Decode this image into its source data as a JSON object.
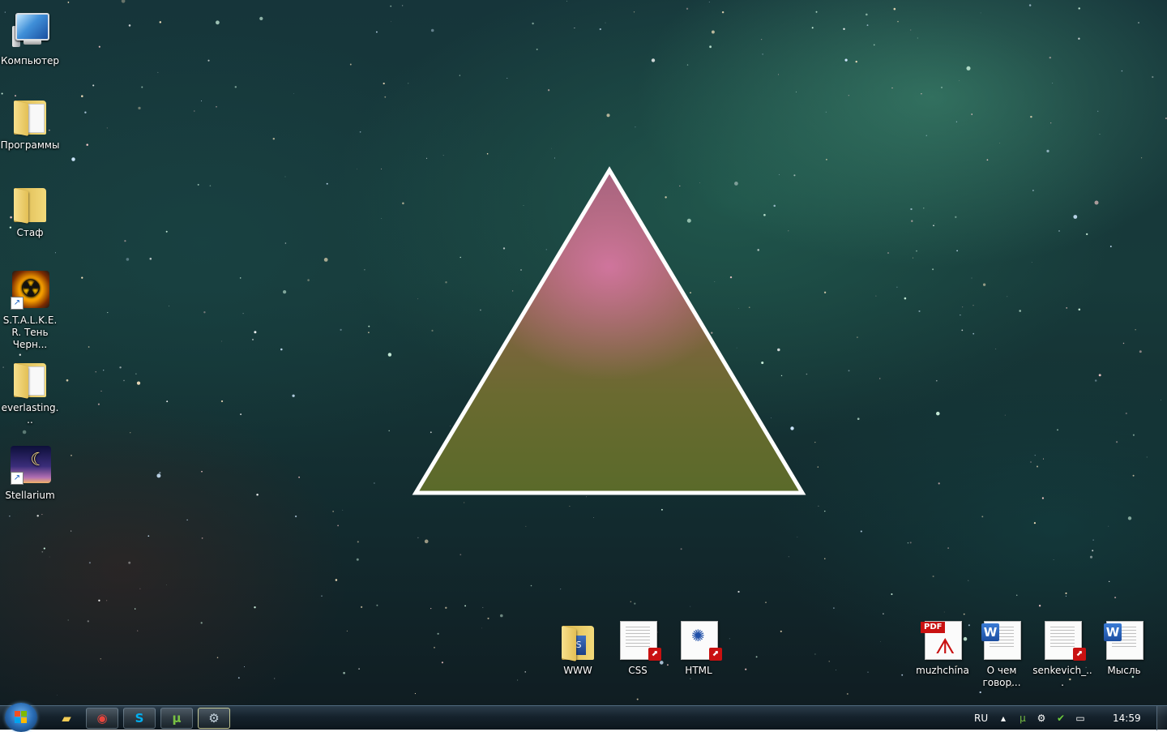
{
  "desktop": {
    "left_icons": [
      {
        "label": "Компьютер"
      },
      {
        "label": "Программы"
      },
      {
        "label": "Стаф"
      },
      {
        "label": "S.T.A.L.K.E.R. Тень Черн..."
      },
      {
        "label": "everlasting..."
      },
      {
        "label": "Stellarium"
      }
    ],
    "bottom_icons": [
      {
        "label": "WWW"
      },
      {
        "label": "CSS"
      },
      {
        "label": "HTML"
      },
      {
        "label": "muzhchina"
      },
      {
        "label": "О чем говор..."
      },
      {
        "label": "senkevich_..."
      },
      {
        "label": "Мысль"
      }
    ],
    "pdf_tag": "PDF",
    "word_letter": "W"
  },
  "taskbar": {
    "language": "RU",
    "clock": "14:59",
    "pinned": [
      {
        "icon": "explorer-icon"
      },
      {
        "icon": "chrome-icon"
      },
      {
        "icon": "skype-icon"
      },
      {
        "icon": "utorrent-icon"
      },
      {
        "icon": "steam-icon"
      }
    ],
    "tray_icons": [
      "show-hidden-icon",
      "utorrent-tray-icon",
      "steam-tray-icon",
      "security-tray-icon",
      "network-icon"
    ]
  },
  "colors": {
    "triangle_stroke": "#ffffff",
    "accent_pdf": "#c91111",
    "accent_word": "#2b5fb8"
  }
}
